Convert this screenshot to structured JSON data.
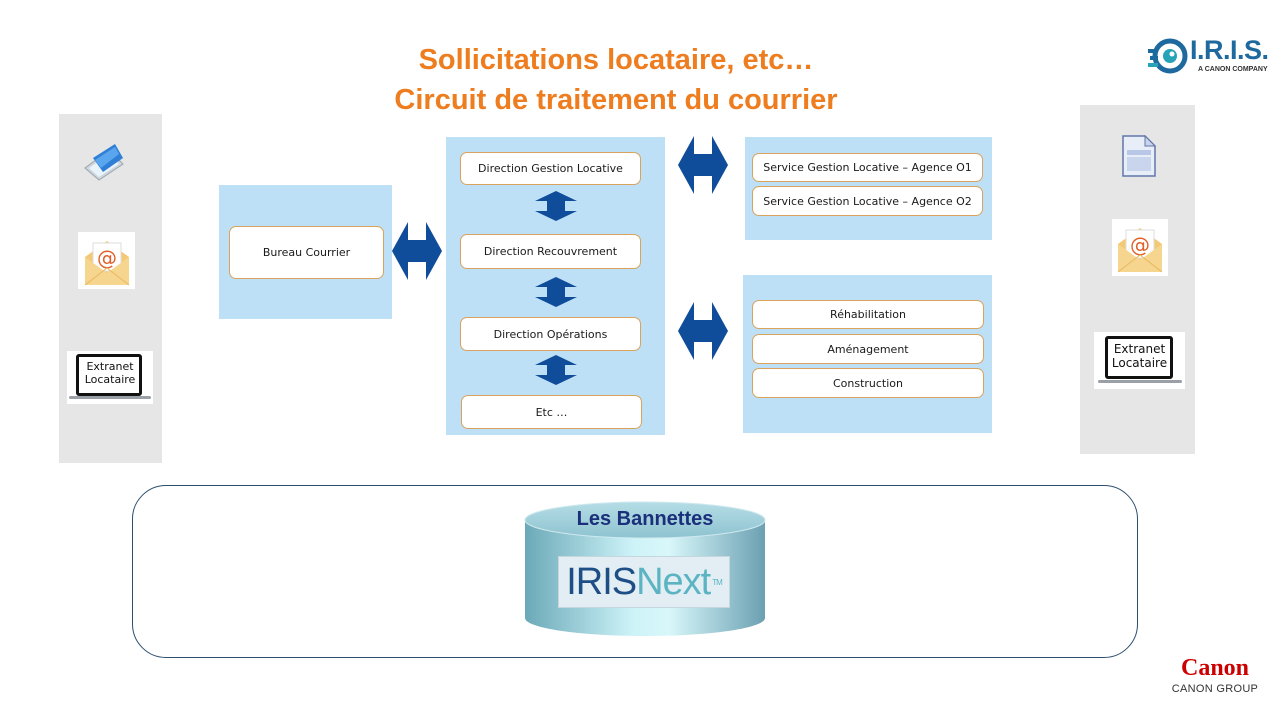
{
  "header": {
    "title_line1": "Sollicitations locataire, etc…",
    "title_line2": "Circuit de traitement du courrier"
  },
  "logos": {
    "iris": {
      "name": "I.R.I.S.",
      "tagline": "A CANON COMPANY",
      "color": "#1E6A9E"
    },
    "canon": {
      "name": "Canon",
      "tagline": "CANON GROUP",
      "color": "#CC0000"
    }
  },
  "left_channels": {
    "items": [
      {
        "icon": "scanner-icon"
      },
      {
        "icon": "email-envelope-icon"
      },
      {
        "icon": "laptop-icon",
        "label_line1": "Extranet",
        "label_line2": "Locataire"
      }
    ]
  },
  "right_channels": {
    "items": [
      {
        "icon": "document-icon"
      },
      {
        "icon": "email-envelope-icon"
      },
      {
        "icon": "laptop-icon",
        "label_line1": "Extranet",
        "label_line2": "Locataire"
      }
    ]
  },
  "bureau": {
    "label": "Bureau Courrier"
  },
  "directions": {
    "items": [
      {
        "label": "Direction Gestion Locative"
      },
      {
        "label": "Direction Recouvrement"
      },
      {
        "label": "Direction Opérations"
      },
      {
        "label": "Etc  …"
      }
    ]
  },
  "services_agences": {
    "items": [
      {
        "label": "Service Gestion Locative – Agence  O1"
      },
      {
        "label": "Service Gestion Locative – Agence  O2"
      }
    ]
  },
  "services_travaux": {
    "items": [
      {
        "label": "Réhabilitation"
      },
      {
        "label": "Aménagement"
      },
      {
        "label": "Construction"
      }
    ]
  },
  "storage": {
    "title": "Les Bannettes",
    "product_iris": "IRIS",
    "product_next": "Next",
    "trademark": "TM"
  },
  "colors": {
    "title_orange": "#ED7D1F",
    "panel_blue": "#BDE0F7",
    "arrow_blue": "#0F4C9A",
    "node_border": "#D9A35E",
    "side_gray": "#E6E6E6"
  }
}
